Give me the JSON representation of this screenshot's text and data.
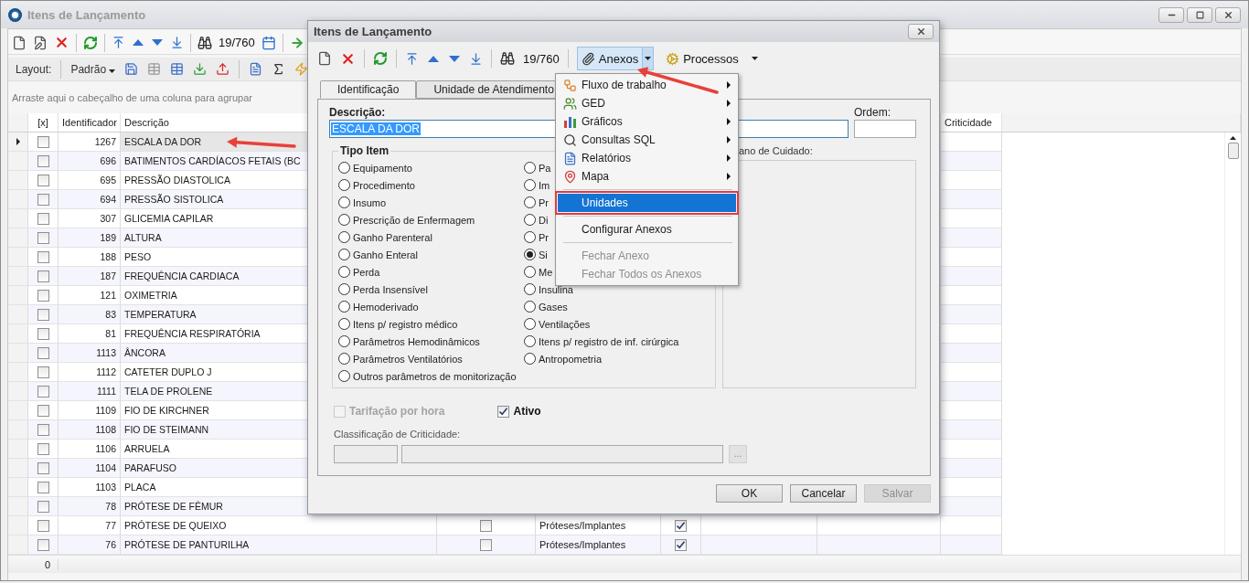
{
  "main_window": {
    "title": "Itens de Lançamento"
  },
  "toolbar": {
    "record_counter": "19/760"
  },
  "layout_bar": {
    "label": "Layout:",
    "layout": "Padrão"
  },
  "group_hint": "Arraste aqui o cabeçalho de uma coluna para agrupar",
  "table": {
    "columns": [
      {
        "label": "[x]"
      },
      {
        "label": "Identificador"
      },
      {
        "label": "Descrição"
      },
      {
        "label": "Criticidade"
      }
    ],
    "rows": [
      {
        "id": "1267",
        "description": "ESCALA DA DOR",
        "checked": false,
        "selected": true
      },
      {
        "id": "696",
        "description": "BATIMENTOS CARDÍACOS FETAIS (BC",
        "checked": false,
        "selected": false
      },
      {
        "id": "695",
        "description": "PRESSÃO DIASTOLICA",
        "checked": false,
        "selected": false
      },
      {
        "id": "694",
        "description": "PRESSÃO SISTOLICA",
        "checked": false,
        "selected": false
      },
      {
        "id": "307",
        "description": "GLICEMIA CAPILAR",
        "checked": false,
        "selected": false
      },
      {
        "id": "189",
        "description": "ALTURA",
        "checked": false,
        "selected": false
      },
      {
        "id": "188",
        "description": "PESO",
        "checked": false,
        "selected": false
      },
      {
        "id": "187",
        "description": "FREQUÊNCIA CARDIACA",
        "checked": false,
        "selected": false
      },
      {
        "id": "121",
        "description": "OXIMETRIA",
        "checked": false,
        "selected": false
      },
      {
        "id": "83",
        "description": "TEMPERATURA",
        "checked": false,
        "selected": false
      },
      {
        "id": "81",
        "description": "FREQUÊNCIA RESPIRATÓRIA",
        "checked": false,
        "selected": false
      },
      {
        "id": "1113",
        "description": "ÂNCORA",
        "checked": false,
        "selected": false
      },
      {
        "id": "1112",
        "description": "CATETER DUPLO J",
        "checked": false,
        "selected": false
      },
      {
        "id": "1111",
        "description": "TELA DE PROLENE",
        "checked": false,
        "selected": false
      },
      {
        "id": "1109",
        "description": "FIO DE KIRCHNER",
        "checked": false,
        "selected": false
      },
      {
        "id": "1108",
        "description": "FIO DE STEIMANN",
        "checked": false,
        "selected": false
      },
      {
        "id": "1106",
        "description": "ARRUELA",
        "checked": false,
        "selected": false
      },
      {
        "id": "1104",
        "description": "PARAFUSO",
        "checked": false,
        "selected": false
      },
      {
        "id": "1103",
        "description": "PLACA",
        "checked": false,
        "selected": false
      },
      {
        "id": "78",
        "description": "PRÓTESE DE FÊMUR",
        "checked": false,
        "selected": false
      },
      {
        "id": "77",
        "description": "PRÓTESE DE QUEIXO",
        "checked": false,
        "selected": false,
        "column_4_checked": false,
        "column_5": "Próteses/Implantes",
        "column_6_checked": true
      },
      {
        "id": "76",
        "description": "PRÓTESE DE PANTURILHA",
        "checked": false,
        "selected": false,
        "column_4_checked": false,
        "column_5": "Próteses/Implantes",
        "column_6_checked": true
      }
    ],
    "footer": "0"
  },
  "dialog": {
    "title": "Itens de Lançamento",
    "record_counter": "19/760",
    "anexos": {
      "label": "Anexos",
      "expanded": true
    },
    "processos": {
      "label": "Processos"
    },
    "tabs": [
      {
        "label": "Identificação",
        "selected": true
      },
      {
        "label": "Unidade de Atendimento",
        "selected": false
      }
    ],
    "descricao_label": "Descrição:",
    "descricao_value": "ESCALA DA DOR",
    "ordem_label": "Ordem:",
    "tipo_item": {
      "title": "Tipo Item",
      "options": [
        {
          "label": "Equipamento",
          "selected": false
        },
        {
          "label": "Procedimento",
          "selected": false
        },
        {
          "label": "Insumo",
          "selected": false
        },
        {
          "label": "Prescrição de Enfermagem",
          "selected": false
        },
        {
          "label": "Ganho Parenteral",
          "selected": false
        },
        {
          "label": "Ganho Enteral",
          "selected": false
        },
        {
          "label": "Perda",
          "selected": false
        },
        {
          "label": "Perda Insensível",
          "selected": false
        },
        {
          "label": "Hemoderivado",
          "selected": false
        },
        {
          "label": "Itens p/ registro médico",
          "selected": false
        },
        {
          "label": "Parâmetros Hemodinâmicos",
          "selected": false
        },
        {
          "label": "Parâmetros Ventilatórios",
          "selected": false
        },
        {
          "label": "Outros parâmetros de monitorização",
          "selected": false
        },
        {
          "label": "Pa",
          "selected": false
        },
        {
          "label": "Im",
          "selected": false
        },
        {
          "label": "Pr",
          "selected": false
        },
        {
          "label": "Di",
          "selected": false
        },
        {
          "label": "Pr",
          "selected": false
        },
        {
          "label": "Si",
          "selected": true
        },
        {
          "label": "Me",
          "selected": false
        },
        {
          "label": "Insulina",
          "selected": false
        },
        {
          "label": "Gases",
          "selected": false
        },
        {
          "label": "Ventilações",
          "selected": false
        },
        {
          "label": "Itens p/ registro de inf. cirúrgica",
          "selected": false
        },
        {
          "label": "Antropometria",
          "selected": false
        }
      ]
    },
    "plano_label": "ano de Cuidado:",
    "tarifacao": {
      "label": "Tarifação por hora",
      "checked": false,
      "disabled": true
    },
    "ativo": {
      "label": "Ativo",
      "checked": true,
      "disabled": false
    },
    "classificacao_label": "Classificação de Criticidade:",
    "browse_button": "...",
    "buttons": [
      {
        "label": "OK",
        "disabled": false
      },
      {
        "label": "Cancelar",
        "disabled": false
      },
      {
        "label": "Salvar",
        "disabled": true
      }
    ]
  },
  "anexos_menu": {
    "items": [
      {
        "kind": "submenu",
        "label": "Fluxo de trabalho",
        "selected": false,
        "disabled": false
      },
      {
        "kind": "submenu",
        "label": "GED",
        "selected": false,
        "disabled": false
      },
      {
        "kind": "submenu",
        "label": "Gráficos",
        "selected": false,
        "disabled": false
      },
      {
        "kind": "submenu",
        "label": "Consultas SQL",
        "selected": false,
        "disabled": false
      },
      {
        "kind": "submenu",
        "label": "Relatórios",
        "selected": false,
        "disabled": false
      },
      {
        "kind": "submenu",
        "label": "Mapa",
        "selected": false,
        "disabled": false
      },
      {
        "kind": "separator"
      },
      {
        "kind": "item",
        "label": "Unidades",
        "selected": true,
        "disabled": false
      },
      {
        "kind": "separator"
      },
      {
        "kind": "item",
        "label": "Configurar Anexos",
        "selected": false,
        "disabled": false
      },
      {
        "kind": "separator"
      },
      {
        "kind": "item",
        "label": "Fechar Anexo",
        "selected": false,
        "disabled": true
      },
      {
        "kind": "item",
        "label": "Fechar Todos os Anexos",
        "selected": false,
        "disabled": true
      }
    ]
  }
}
